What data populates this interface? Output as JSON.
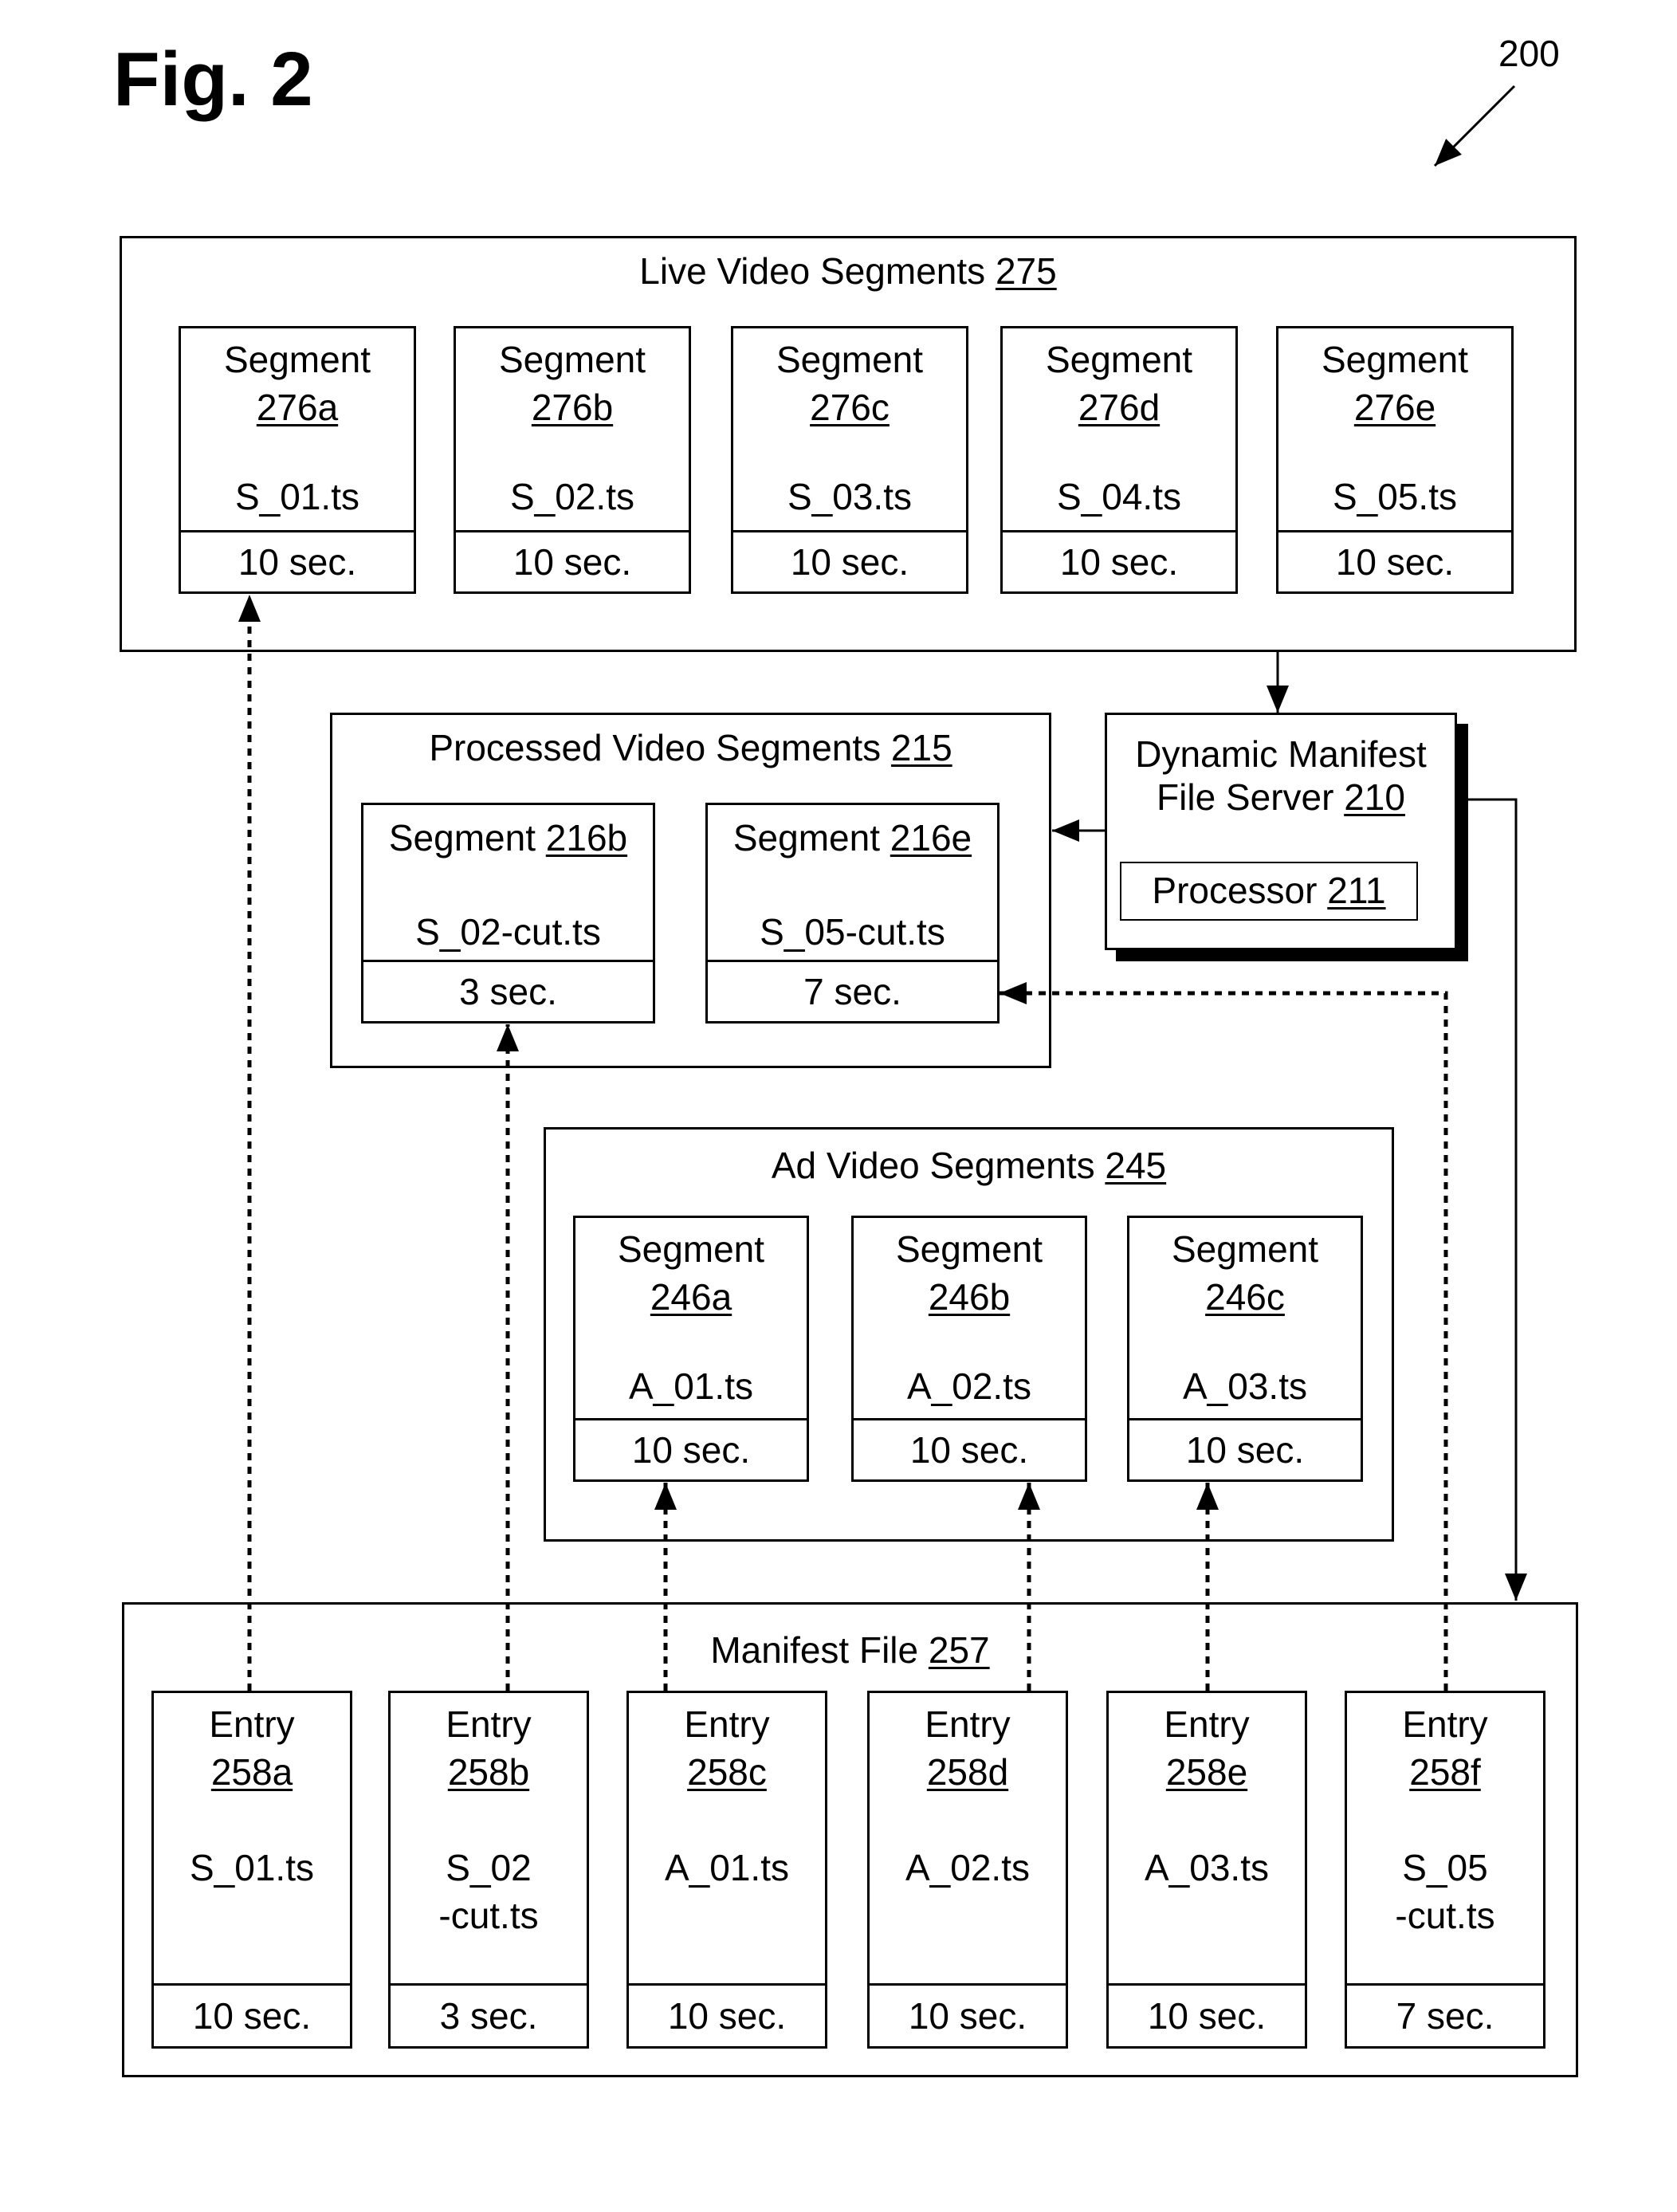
{
  "figure": {
    "title": "Fig. 2",
    "reference_number": "200"
  },
  "live_video_segments": {
    "title": "Live Video Segments",
    "ref": "275",
    "segments": [
      {
        "label": "Segment",
        "ref": "276a",
        "file": "S_01.ts",
        "duration": "10 sec."
      },
      {
        "label": "Segment",
        "ref": "276b",
        "file": "S_02.ts",
        "duration": "10 sec."
      },
      {
        "label": "Segment",
        "ref": "276c",
        "file": "S_03.ts",
        "duration": "10 sec."
      },
      {
        "label": "Segment",
        "ref": "276d",
        "file": "S_04.ts",
        "duration": "10 sec."
      },
      {
        "label": "Segment",
        "ref": "276e",
        "file": "S_05.ts",
        "duration": "10 sec."
      }
    ]
  },
  "processed_video_segments": {
    "title": "Processed Video Segments",
    "ref": "215",
    "segments": [
      {
        "label": "Segment",
        "ref": "216b",
        "file": "S_02-cut.ts",
        "duration": "3 sec."
      },
      {
        "label": "Segment",
        "ref": "216e",
        "file": "S_05-cut.ts",
        "duration": "7 sec."
      }
    ]
  },
  "server": {
    "title_line1": "Dynamic Manifest",
    "title_line2": "File Server",
    "ref": "210",
    "processor_label": "Processor",
    "processor_ref": "211"
  },
  "ad_video_segments": {
    "title": "Ad Video Segments",
    "ref": "245",
    "segments": [
      {
        "label": "Segment",
        "ref": "246a",
        "file": "A_01.ts",
        "duration": "10 sec."
      },
      {
        "label": "Segment",
        "ref": "246b",
        "file": "A_02.ts",
        "duration": "10 sec."
      },
      {
        "label": "Segment",
        "ref": "246c",
        "file": "A_03.ts",
        "duration": "10 sec."
      }
    ]
  },
  "manifest_file": {
    "title": "Manifest File",
    "ref": "257",
    "entries": [
      {
        "label": "Entry",
        "ref": "258a",
        "file_line1": "S_01.ts",
        "file_line2": "",
        "duration": "10 sec."
      },
      {
        "label": "Entry",
        "ref": "258b",
        "file_line1": "S_02",
        "file_line2": "-cut.ts",
        "duration": "3 sec."
      },
      {
        "label": "Entry",
        "ref": "258c",
        "file_line1": "A_01.ts",
        "file_line2": "",
        "duration": "10 sec."
      },
      {
        "label": "Entry",
        "ref": "258d",
        "file_line1": "A_02.ts",
        "file_line2": "",
        "duration": "10 sec."
      },
      {
        "label": "Entry",
        "ref": "258e",
        "file_line1": "A_03.ts",
        "file_line2": "",
        "duration": "10 sec."
      },
      {
        "label": "Entry",
        "ref": "258f",
        "file_line1": "S_05",
        "file_line2": "-cut.ts",
        "duration": "7 sec."
      }
    ]
  },
  "connections": [
    {
      "from": "entry-258a",
      "to": "segment-276a",
      "style": "dashed"
    },
    {
      "from": "entry-258b",
      "to": "segment-216b",
      "style": "dashed"
    },
    {
      "from": "entry-258c",
      "to": "segment-246a",
      "style": "dashed"
    },
    {
      "from": "entry-258d",
      "to": "segment-246b",
      "style": "dashed"
    },
    {
      "from": "entry-258e",
      "to": "segment-246c",
      "style": "dashed"
    },
    {
      "from": "entry-258f",
      "to": "segment-216e",
      "style": "dashed"
    },
    {
      "from": "live-video-segments",
      "to": "dynamic-manifest-file-server",
      "style": "solid"
    },
    {
      "from": "dynamic-manifest-file-server",
      "to": "processed-video-segments",
      "style": "solid"
    },
    {
      "from": "dynamic-manifest-file-server",
      "to": "manifest-file",
      "style": "solid"
    }
  ]
}
